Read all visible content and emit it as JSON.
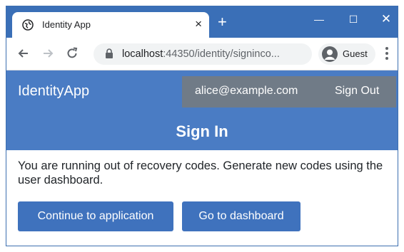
{
  "browser": {
    "tab_title": "Identity App",
    "tab_close": "×",
    "new_tab": "+",
    "window_min": "—",
    "window_max": "☐",
    "window_close": "✕",
    "url_host": "localhost",
    "url_path": ":44350/identity/signinco...",
    "profile_label": "Guest"
  },
  "page": {
    "brand": "IdentityApp",
    "user_email": "alice@example.com",
    "sign_out": "Sign Out",
    "heading": "Sign In",
    "message": "You are running out of recovery codes. Generate new codes using the user dashboard.",
    "continue_button": "Continue to application",
    "dashboard_button": "Go to dashboard"
  },
  "colors": {
    "browser_accent": "#3a6fb7",
    "navbar": "#4a7cc4",
    "userbox": "#707b87",
    "button": "#3f72bd"
  },
  "icons": [
    "globe-icon",
    "close-icon",
    "plus-icon",
    "back-arrow-icon",
    "forward-arrow-icon",
    "reload-icon",
    "lock-icon",
    "avatar-icon",
    "more-vert-icon"
  ]
}
